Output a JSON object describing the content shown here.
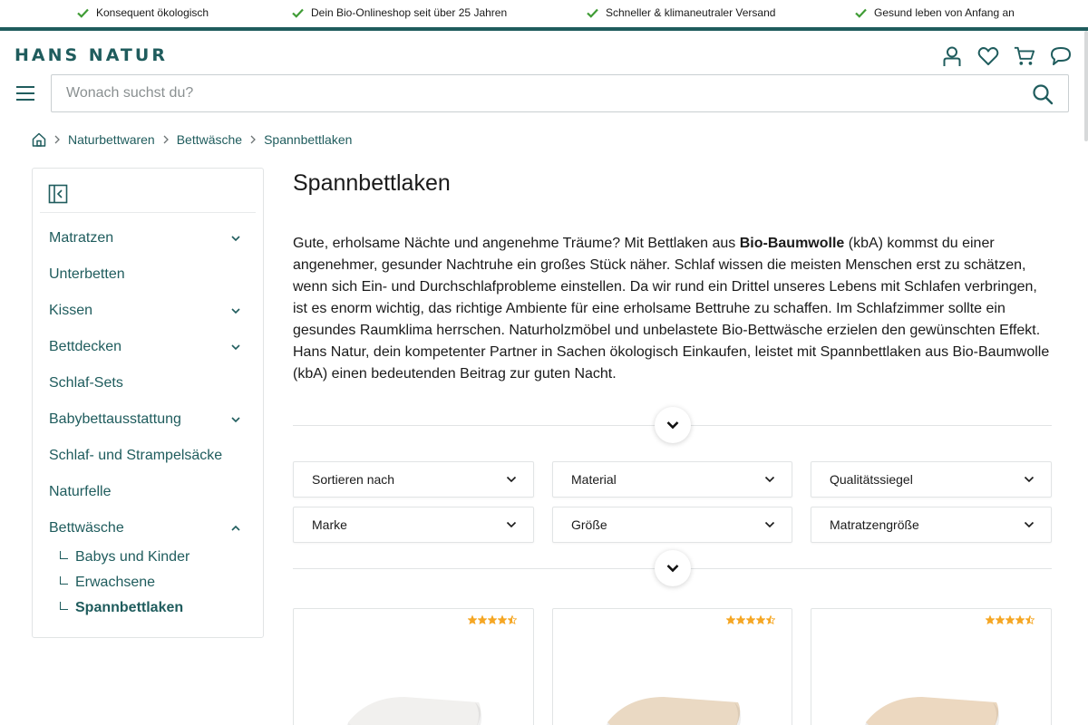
{
  "usp": [
    "Konsequent ökologisch",
    "Dein Bio-Onlineshop seit über 25 Jahren",
    "Schneller & klimaneutraler Versand",
    "Gesund leben von Anfang an"
  ],
  "header": {
    "logo": "HANS NATUR",
    "search_placeholder": "Wonach suchst du?"
  },
  "breadcrumb": [
    "Naturbettwaren",
    "Bettwäsche",
    "Spannbettlaken"
  ],
  "sidebar": {
    "categories": [
      {
        "label": "Matratzen",
        "expandable": true
      },
      {
        "label": "Unterbetten",
        "expandable": false
      },
      {
        "label": "Kissen",
        "expandable": true
      },
      {
        "label": "Bettdecken",
        "expandable": true
      },
      {
        "label": "Schlaf-Sets",
        "expandable": false
      },
      {
        "label": "Babybettausstattung",
        "expandable": true
      },
      {
        "label": "Schlaf- und Strampelsäcke",
        "expandable": false
      },
      {
        "label": "Naturfelle",
        "expandable": false
      },
      {
        "label": "Bettwäsche",
        "expandable": true,
        "expanded": true
      }
    ],
    "subcategories": [
      "Babys und Kinder",
      "Erwachsene",
      "Spannbettlaken"
    ],
    "active_sub": "Spannbettlaken"
  },
  "main": {
    "title": "Spannbettlaken",
    "intro_pre": "Gute, erholsame Nächte und angenehme Träume? Mit Bettlaken aus ",
    "intro_bold": "Bio-Baumwolle",
    "intro_post": " (kbA) kommst du einer angenehmer, gesunder Nachtruhe ein großes Stück näher. Schlaf wissen die meisten Menschen erst zu schätzen, wenn sich Ein- und Durchschlafprobleme einstellen. Da wir rund ein Drittel unseres Lebens mit Schlafen verbringen, ist es enorm wichtig, das richtige Ambiente für eine erholsame Bettruhe zu schaffen. Im Schlafzimmer sollte ein gesundes Raumklima herrschen. Naturholzmöbel und unbelastete Bio-Bettwäsche erzielen den gewünschten Effekt.",
    "intro_line2": "Hans Natur, dein kompetenter Partner in Sachen ökologisch Einkaufen, leistet mit Spannbettlaken aus Bio-Baumwolle (kbA) einen bedeutenden Beitrag zur guten Nacht."
  },
  "filters": [
    "Sortieren nach",
    "Material",
    "Qualitätssiegel",
    "Marke",
    "Größe",
    "Matratzengröße"
  ],
  "products": [
    {
      "rating": 4.5,
      "color": "#f1f0ee"
    },
    {
      "rating": 4.5,
      "color": "#ead9c3"
    },
    {
      "rating": 4.5,
      "color": "#ecd8c0"
    }
  ],
  "colors": {
    "brand": "#1f5c5d",
    "check": "#3f9c35",
    "star": "#f5a623"
  }
}
